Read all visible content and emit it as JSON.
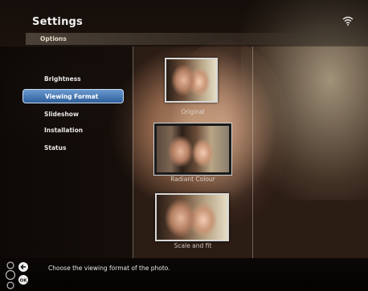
{
  "header": {
    "title": "Settings",
    "subtitle": "Options"
  },
  "menu": {
    "items": [
      {
        "label": "Brightness",
        "selected": false
      },
      {
        "label": "Viewing Format",
        "selected": true
      },
      {
        "label": "Slideshow",
        "selected": false
      },
      {
        "label": "Installation",
        "selected": false
      },
      {
        "label": "Status",
        "selected": false
      }
    ]
  },
  "formats": [
    {
      "label": "Original",
      "selected": false
    },
    {
      "label": "Radiant Colour",
      "selected": true
    },
    {
      "label": "Scale and fit",
      "selected": false
    }
  ],
  "status_bar": {
    "help_text": "Choose the viewing format of the photo.",
    "icons": [
      "navigation-ring-icon",
      "back-icon",
      "ok-icon"
    ]
  },
  "indicators": {
    "wifi": "wifi-icon"
  },
  "colors": {
    "selection_fill": "#2f5f9a",
    "selection_border": "#c9ddf3"
  }
}
